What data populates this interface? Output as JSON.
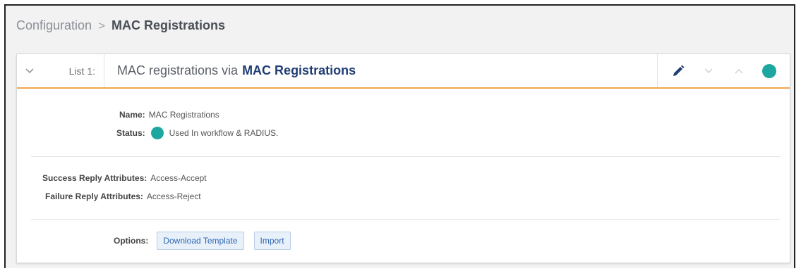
{
  "breadcrumb": {
    "root": "Configuration",
    "separator": ">",
    "current": "MAC Registrations"
  },
  "panel": {
    "list_label": "List 1:",
    "title_prefix": "MAC registrations via",
    "title_link": "MAC Registrations",
    "actions": {
      "edit_icon": "pencil-icon",
      "move_down_icon": "chevron-down-icon",
      "move_up_icon": "chevron-up-icon",
      "status_color": "#1ea6a0"
    }
  },
  "details": {
    "name_label": "Name:",
    "name_value": "MAC Registrations",
    "status_label": "Status:",
    "status_value": "Used In workflow & RADIUS.",
    "success_label": "Success Reply Attributes:",
    "success_value": "Access-Accept",
    "failure_label": "Failure Reply Attributes:",
    "failure_value": "Access-Reject",
    "options_label": "Options:",
    "download_button": "Download Template",
    "import_button": "Import"
  },
  "colors": {
    "accent_underline": "#f0a64a",
    "link": "#1f3d73",
    "status": "#1ea6a0",
    "button_text": "#2f67b0"
  }
}
